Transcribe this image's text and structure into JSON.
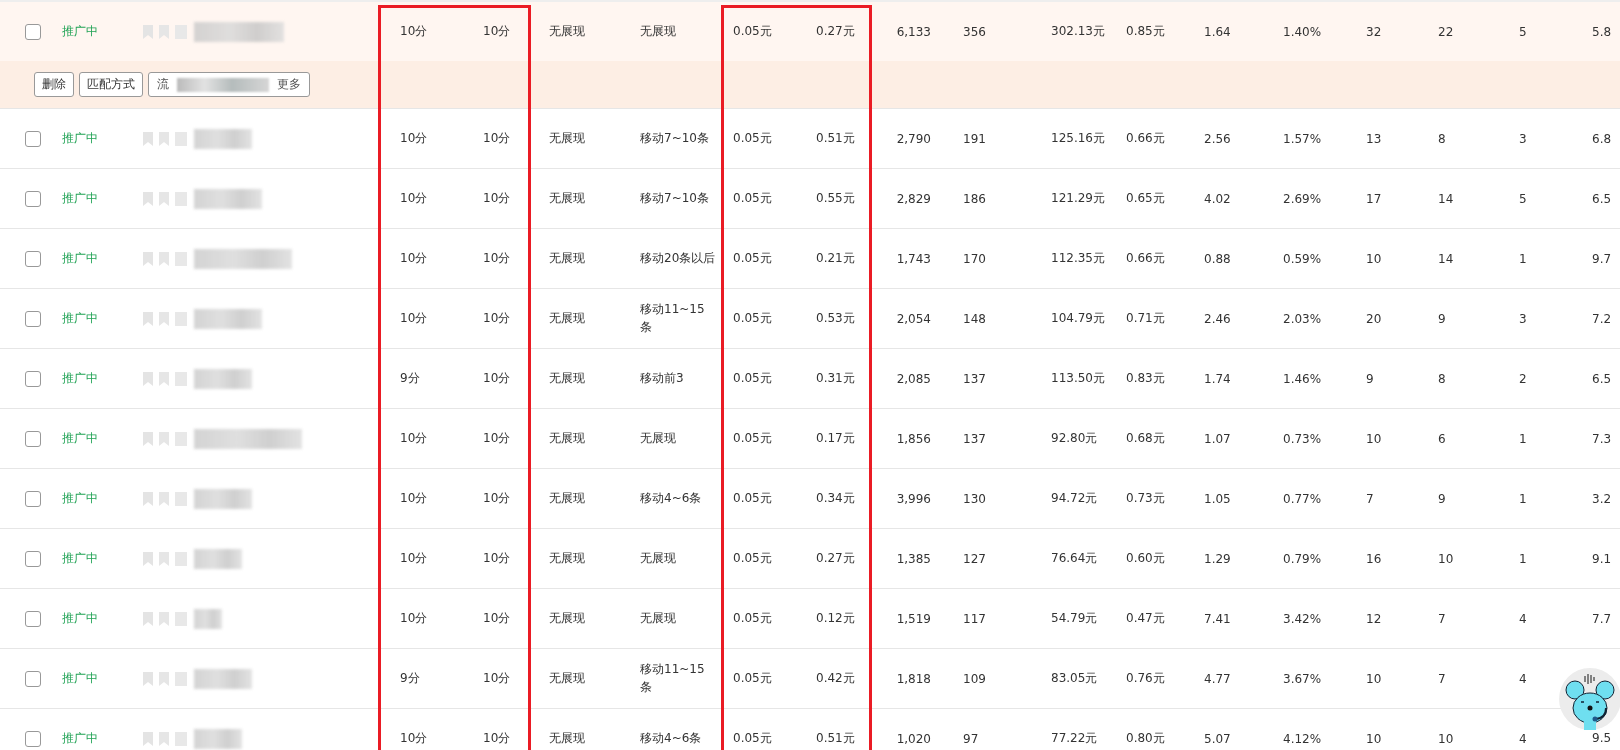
{
  "rows": [
    {
      "checked": false,
      "selected": true,
      "status": "推广中",
      "cells": [
        "10分",
        "10分",
        "无展现",
        "无展现",
        "0.05元",
        "0.27元",
        "6,133",
        "356",
        "302.13元",
        "0.85元",
        "1.64",
        "1.40%",
        "32",
        "22",
        "5",
        "5.8"
      ],
      "actions": [
        {
          "kind": "button",
          "label": "删除"
        },
        {
          "kind": "button",
          "label": "匹配方式"
        },
        {
          "kind": "blurred",
          "label": "流",
          "label_end": "更多"
        }
      ]
    },
    {
      "checked": false,
      "selected": false,
      "status": "推广中",
      "cells": [
        "10分",
        "10分",
        "无展现",
        "移动7~10条",
        "0.05元",
        "0.51元",
        "2,790",
        "191",
        "125.16元",
        "0.66元",
        "2.56",
        "1.57%",
        "13",
        "8",
        "3",
        "6.8"
      ]
    },
    {
      "checked": false,
      "selected": false,
      "status": "推广中",
      "cells": [
        "10分",
        "10分",
        "无展现",
        "移动7~10条",
        "0.05元",
        "0.55元",
        "2,829",
        "186",
        "121.29元",
        "0.65元",
        "4.02",
        "2.69%",
        "17",
        "14",
        "5",
        "6.5"
      ]
    },
    {
      "checked": false,
      "selected": false,
      "status": "推广中",
      "cells": [
        "10分",
        "10分",
        "无展现",
        "移动20条以后",
        "0.05元",
        "0.21元",
        "1,743",
        "170",
        "112.35元",
        "0.66元",
        "0.88",
        "0.59%",
        "10",
        "14",
        "1",
        "9.7"
      ]
    },
    {
      "checked": false,
      "selected": false,
      "status": "推广中",
      "cells": [
        "10分",
        "10分",
        "无展现",
        "移动11~15条",
        "0.05元",
        "0.53元",
        "2,054",
        "148",
        "104.79元",
        "0.71元",
        "2.46",
        "2.03%",
        "20",
        "9",
        "3",
        "7.2"
      ]
    },
    {
      "checked": false,
      "selected": false,
      "status": "推广中",
      "cells": [
        "9分",
        "10分",
        "无展现",
        "移动前3",
        "0.05元",
        "0.31元",
        "2,085",
        "137",
        "113.50元",
        "0.83元",
        "1.74",
        "1.46%",
        "9",
        "8",
        "2",
        "6.5"
      ]
    },
    {
      "checked": false,
      "selected": false,
      "status": "推广中",
      "cells": [
        "10分",
        "10分",
        "无展现",
        "无展现",
        "0.05元",
        "0.17元",
        "1,856",
        "137",
        "92.80元",
        "0.68元",
        "1.07",
        "0.73%",
        "10",
        "6",
        "1",
        "7.3"
      ]
    },
    {
      "checked": false,
      "selected": false,
      "status": "推广中",
      "cells": [
        "10分",
        "10分",
        "无展现",
        "移动4~6条",
        "0.05元",
        "0.34元",
        "3,996",
        "130",
        "94.72元",
        "0.73元",
        "1.05",
        "0.77%",
        "7",
        "9",
        "1",
        "3.2"
      ]
    },
    {
      "checked": false,
      "selected": false,
      "status": "推广中",
      "cells": [
        "10分",
        "10分",
        "无展现",
        "无展现",
        "0.05元",
        "0.27元",
        "1,385",
        "127",
        "76.64元",
        "0.60元",
        "1.29",
        "0.79%",
        "16",
        "10",
        "1",
        "9.1"
      ]
    },
    {
      "checked": false,
      "selected": false,
      "status": "推广中",
      "cells": [
        "10分",
        "10分",
        "无展现",
        "无展现",
        "0.05元",
        "0.12元",
        "1,519",
        "117",
        "54.79元",
        "0.47元",
        "7.41",
        "3.42%",
        "12",
        "7",
        "4",
        "7.7"
      ]
    },
    {
      "checked": false,
      "selected": false,
      "status": "推广中",
      "cells": [
        "9分",
        "10分",
        "无展现",
        "移动11~15条",
        "0.05元",
        "0.42元",
        "1,818",
        "109",
        "83.05元",
        "0.76元",
        "4.77",
        "3.67%",
        "10",
        "7",
        "4"
      ]
    },
    {
      "checked": false,
      "selected": false,
      "status": "推广中",
      "cells": [
        "10分",
        "10分",
        "无展现",
        "移动4~6条",
        "0.05元",
        "0.51元",
        "1,020",
        "97",
        "77.22元",
        "0.80元",
        "5.07",
        "4.12%",
        "10",
        "10",
        "4",
        "9.5"
      ]
    }
  ]
}
